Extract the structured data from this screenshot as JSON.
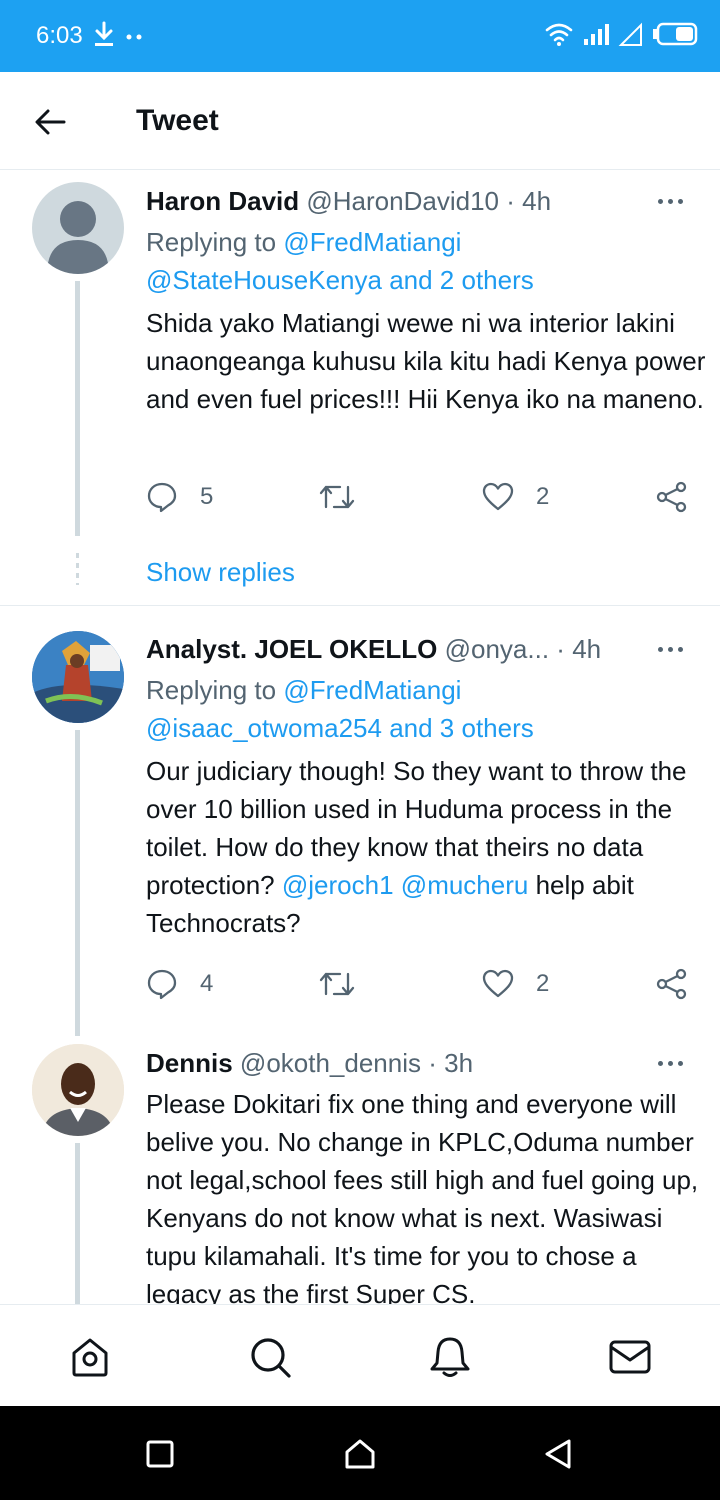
{
  "status_bar": {
    "time": "6:03",
    "left_icons": [
      "download-icon",
      "more-dots-icon"
    ],
    "right_icons": [
      "wifi-icon",
      "signal-icon",
      "signal-empty-icon",
      "battery-icon"
    ],
    "background": "#1da1f2"
  },
  "header": {
    "title": "Tweet",
    "back_icon": "arrow-left-icon"
  },
  "colors": {
    "accent": "#1d9bf0",
    "muted": "#536471",
    "text": "#0f1419"
  },
  "tweets": [
    {
      "name": "Haron David",
      "handle": "@HaronDavid10",
      "sep": "·",
      "time": "4h",
      "replying_prefix": "Replying to",
      "replying_first": "@FredMatiangi",
      "replying_second": "@StateHouseKenya and 2 others",
      "text": "Shida yako Matiangi wewe ni wa interior lakini unaongeanga kuhusu kila kitu hadi Kenya power and even fuel prices!!! Hii Kenya iko na maneno.",
      "reply_count": "5",
      "like_count": "2",
      "show_replies": "Show replies"
    },
    {
      "name": "Analyst. JOEL OKELLO",
      "handle": "@onya...",
      "sep": "·",
      "time": "4h",
      "replying_prefix": "Replying to",
      "replying_first": "@FredMatiangi",
      "replying_second": "@isaac_otwoma254 and 3 others",
      "text_part1": "Our judiciary though! So they want to throw the over 10 billion used in Huduma process in the toilet. How do they know that theirs no data protection?",
      "mention1": "@jeroch1",
      "mention2": "@mucheru",
      "text_part2": "help abit Technocrats?",
      "reply_count": "4",
      "like_count": "2"
    },
    {
      "name": "Dennis",
      "handle": "@okoth_dennis",
      "sep": "·",
      "time": "3h",
      "text": "Please Dokitari fix one thing and everyone will belive you. No change in KPLC,Oduma number not legal,school fees still high and fuel going up, Kenyans do not know what is next. Wasiwasi tupu kilamahali. It's time for you to chose a legacy as the first Super CS."
    }
  ],
  "bottom_nav": [
    "home-icon",
    "search-icon",
    "notifications-icon",
    "messages-icon"
  ],
  "system_nav": [
    "recents-icon",
    "home-icon",
    "back-icon"
  ]
}
